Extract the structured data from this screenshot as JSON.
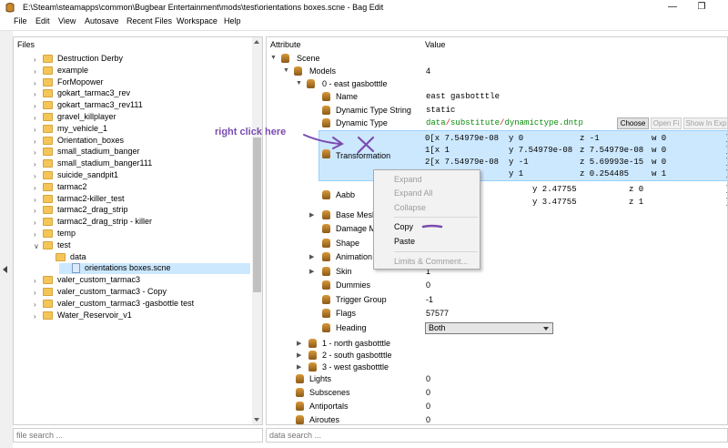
{
  "window": {
    "title": "E:\\Steam\\steamapps\\common\\Bugbear Entertainment\\mods\\test\\orientations boxes.scne - Bag Edit"
  },
  "menu": [
    "File",
    "Edit",
    "View",
    "Autosave",
    "Recent Files",
    "Workspace",
    "Help"
  ],
  "files": {
    "header": "Files",
    "items": [
      "Destruction Derby",
      "example",
      "ForMopower",
      "gokart_tarmac3_rev",
      "gokart_tarmac3_rev111",
      "gravel_killplayer",
      "my_vehicle_1",
      "Orientation_boxes",
      "small_stadium_banger",
      "small_stadium_banger111",
      "suicide_sandpit1",
      "tarmac2",
      "tarmac2-killer_test",
      "tarmac2_drag_strip",
      "tarmac2_drag_strip - killer",
      "temp",
      "test",
      "data",
      "orientations boxes.scne",
      "valer_custom_tarmac3",
      "valer_custom_tarmac3 - Copy",
      "valer_custom_tarmac3 -gasbottle test",
      "Water_Reservoir_v1"
    ],
    "search_placeholder": "file search ..."
  },
  "attributes": {
    "col_attribute": "Attribute",
    "col_value": "Value",
    "scene": "Scene",
    "models": "Models",
    "models_count": "4",
    "model0": "0 - east gasbotttle",
    "name_label": "Name",
    "name_value": "east gasbotttle",
    "dts_label": "Dynamic Type String",
    "dts_value": "static",
    "dt_label": "Dynamic Type",
    "dt_part1": "data",
    "dt_slash1": "/",
    "dt_part2": "substitute",
    "dt_slash2": "/",
    "dt_part3": "dynamictype.dntp",
    "btn_choose": "Choose",
    "btn_open": "Open Fi",
    "btn_show": "Show In Exp",
    "transformation_label": "Transformation",
    "matrix": [
      [
        "0[x 7.54979e-08",
        "y 0",
        "z -1",
        "w 0",
        "]"
      ],
      [
        "1[x 1",
        "y 7.54979e-08",
        "z 7.54979e-08",
        "w 0",
        "]"
      ],
      [
        "2[x 7.54979e-08",
        "y -1",
        "z 5.69993e-15",
        "w 0",
        "]"
      ],
      [
        "",
        "y 1",
        "z 0.254485",
        "w 1",
        "]"
      ]
    ],
    "aabb_label": "Aabb",
    "aabb_rows": [
      [
        "y 2.47755",
        "z 0",
        "]"
      ],
      [
        "y 3.47755",
        "z 1",
        "]"
      ]
    ],
    "base_mesh_label": "Base Mesh",
    "damage_label": "Damage M",
    "shape_label": "Shape",
    "animation_label": "Animation",
    "skin_label": "Skin",
    "skin_value": "1",
    "dummies_label": "Dummies",
    "dummies_value": "0",
    "trigger_label": "Trigger Group",
    "trigger_value": "-1",
    "flags_label": "Flags",
    "flags_value": "57577",
    "heading_label": "Heading",
    "heading_value": "Both",
    "model1": "1 - north gasbotttle",
    "model2": "2 - south gasbotttle",
    "model3": "3 - west gasbotttle",
    "lights_label": "Lights",
    "lights_value": "0",
    "subscenes_label": "Subscenes",
    "subscenes_value": "0",
    "antiportals_label": "Antiportals",
    "antiportals_value": "0",
    "airoutes_label": "Airoutes",
    "airoutes_value": "0",
    "search_placeholder": "data search ..."
  },
  "context_menu": {
    "expand": "Expand",
    "expand_all": "Expand All",
    "collapse": "Collapse",
    "copy": "Copy",
    "paste": "Paste",
    "limits": "Limits & Comment..."
  },
  "annotation": {
    "text": "right click here"
  },
  "colors": {
    "selection": "#cce8ff",
    "path_green": "#0a8a0a",
    "path_red": "#c81e1e",
    "annotation_purple": "#7a4bb0"
  }
}
